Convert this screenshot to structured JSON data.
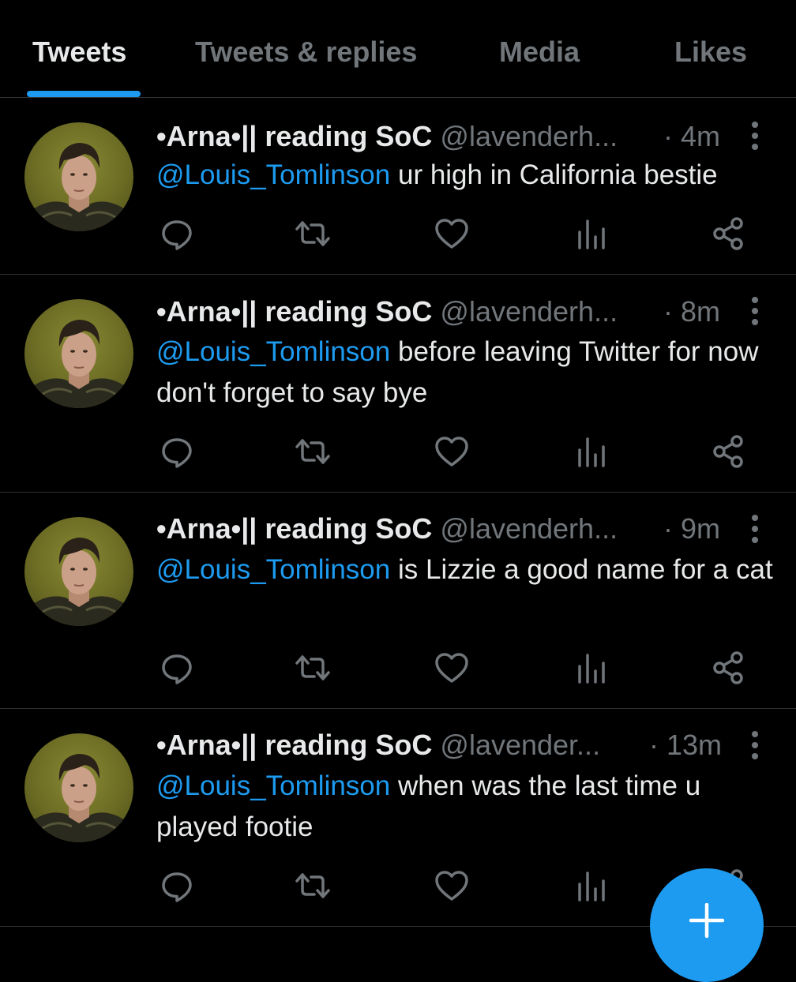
{
  "tabs": [
    {
      "label": "Tweets",
      "active": true
    },
    {
      "label": "Tweets & replies",
      "active": false
    },
    {
      "label": "Media",
      "active": false
    },
    {
      "label": "Likes",
      "active": false
    }
  ],
  "colors": {
    "accent": "#1d9bf0",
    "muted_text": "#71767b",
    "primary_text": "#e7e9ea",
    "background": "#000000",
    "divider": "#2f3336"
  },
  "tweets": [
    {
      "display_name": "•Arna•|| reading SoC",
      "handle": "@lavenderh...",
      "time": "· 4m",
      "mention": "@Louis_Tomlinson",
      "text": " ur high in California bestie"
    },
    {
      "display_name": "•Arna•|| reading SoC",
      "handle": "@lavenderh...",
      "time": "· 8m",
      "mention": "@Louis_Tomlinson",
      "text": " before leaving Twitter for now don't forget to say bye"
    },
    {
      "display_name": "•Arna•|| reading SoC",
      "handle": "@lavenderh...",
      "time": "· 9m",
      "mention": "@Louis_Tomlinson",
      "text": " is Lizzie a good name for a cat"
    },
    {
      "display_name": "•Arna•|| reading SoC",
      "handle": "@lavender...",
      "time": "· 13m",
      "mention": "@Louis_Tomlinson",
      "text": " when was the last time u played footie"
    }
  ],
  "action_icons": [
    "reply-icon",
    "retweet-icon",
    "like-icon",
    "views-icon",
    "share-icon"
  ],
  "fab": {
    "icon": "plus-icon"
  }
}
